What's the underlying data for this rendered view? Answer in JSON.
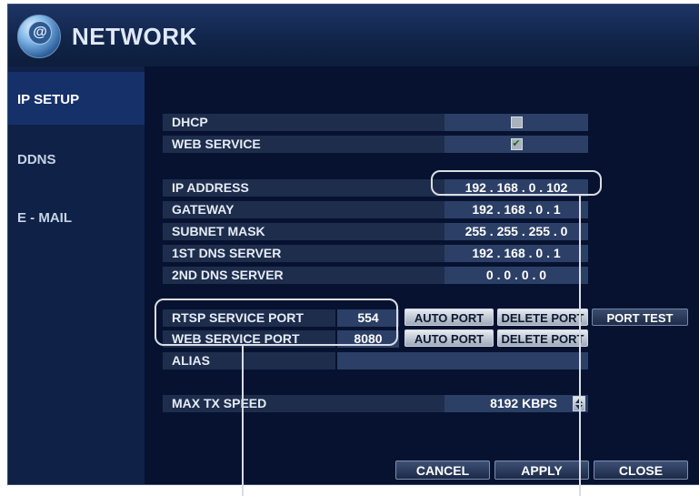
{
  "window": {
    "title": "NETWORK",
    "logo_glyph": "@"
  },
  "sidebar": {
    "items": [
      {
        "label": "IP SETUP",
        "active": true
      },
      {
        "label": "DDNS",
        "active": false
      },
      {
        "label": "E - MAIL",
        "active": false
      }
    ]
  },
  "settings": {
    "dhcp": {
      "label": "DHCP",
      "checked": false
    },
    "web_service": {
      "label": "WEB SERVICE",
      "checked": true,
      "check_glyph": "✔"
    },
    "ip_address": {
      "label": "IP ADDRESS",
      "value": "192 . 168 .  0  . 102"
    },
    "gateway": {
      "label": "GATEWAY",
      "value": "192 . 168 .  0  .  1"
    },
    "subnet_mask": {
      "label": "SUBNET MASK",
      "value": "255 . 255 . 255 .  0"
    },
    "dns1": {
      "label": "1ST DNS SERVER",
      "value": "192 . 168 .  0  .  1"
    },
    "dns2": {
      "label": "2ND DNS SERVER",
      "value": "0  .  0  .  0  .  0"
    },
    "rtsp_port": {
      "label": "RTSP SERVICE PORT",
      "value": "554"
    },
    "web_port": {
      "label": "WEB SERVICE PORT",
      "value": "8080"
    },
    "alias": {
      "label": "ALIAS",
      "value": ""
    },
    "max_tx": {
      "label": "MAX TX SPEED",
      "value": "8192 KBPS"
    }
  },
  "buttons": {
    "auto_port": "AUTO PORT",
    "delete_port": "DELETE PORT",
    "port_test": "PORT TEST",
    "cancel": "CANCEL",
    "apply": "APPLY",
    "close": "CLOSE"
  },
  "colors": {
    "background": "#061230",
    "label_row": "#1e2d4c",
    "value_box": "#2c3f66",
    "callout": "#d9dde4"
  }
}
